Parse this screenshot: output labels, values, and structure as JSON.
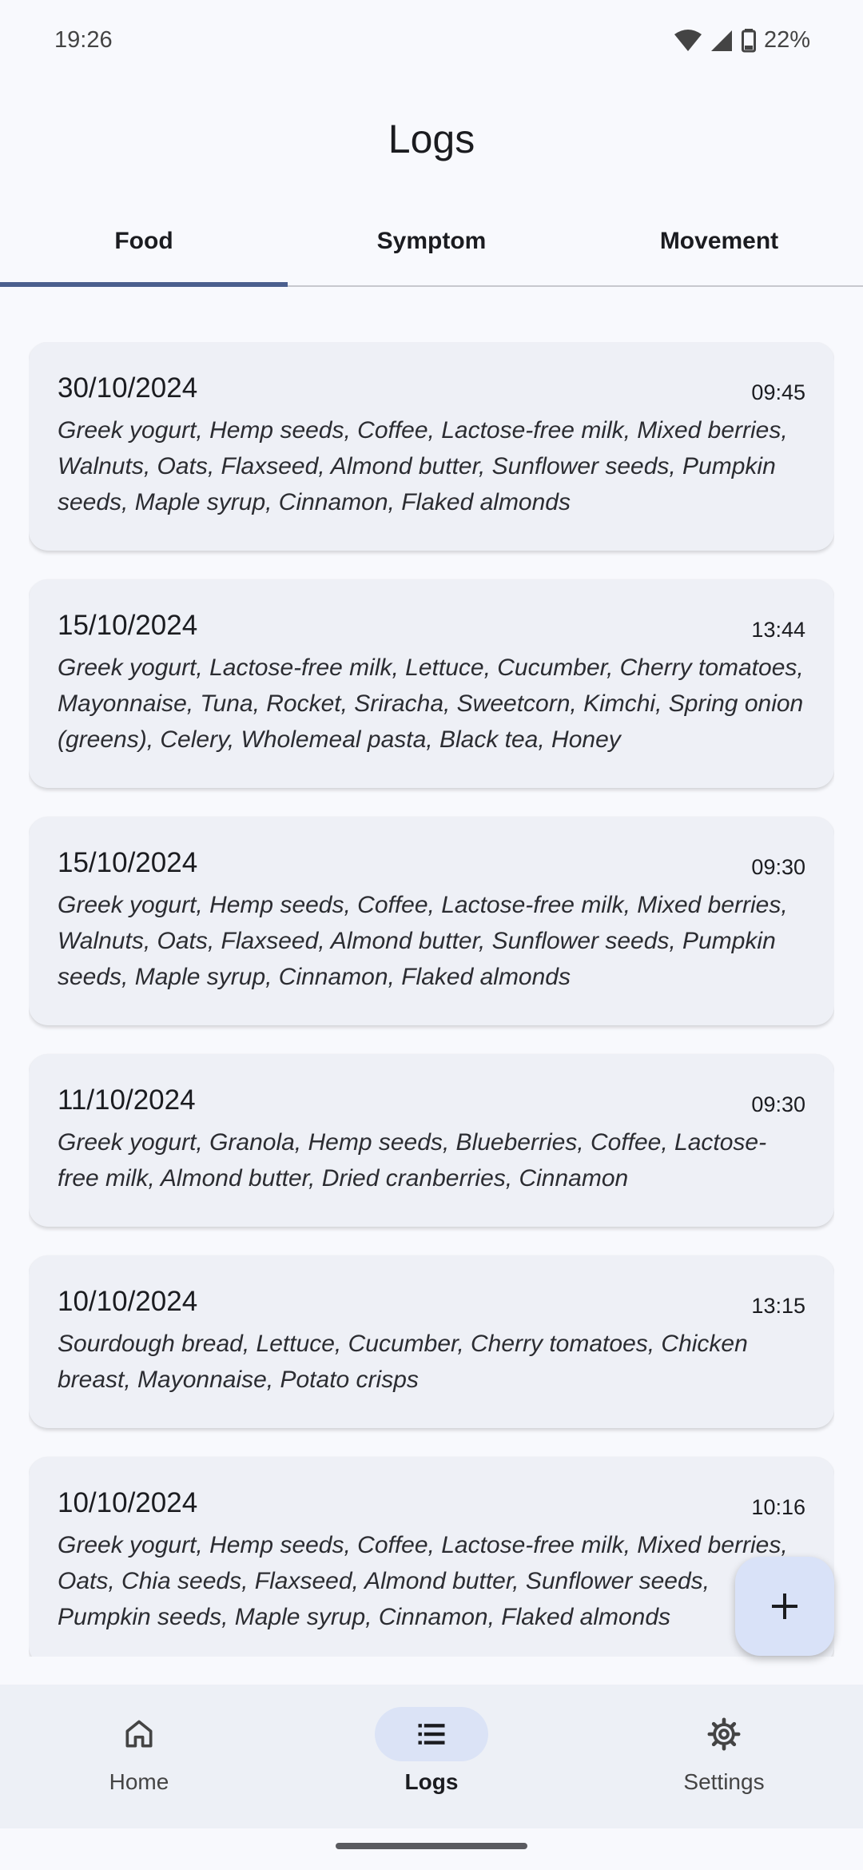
{
  "status": {
    "time": "19:26",
    "battery": "22%"
  },
  "header": {
    "title": "Logs"
  },
  "tabs": [
    {
      "label": "Food",
      "active": true
    },
    {
      "label": "Symptom",
      "active": false
    },
    {
      "label": "Movement",
      "active": false
    }
  ],
  "logs": [
    {
      "date": "30/10/2024",
      "time": "09:45",
      "items": "Greek yogurt, Hemp seeds, Coffee, Lactose-free milk, Mixed berries, Walnuts, Oats, Flaxseed, Almond butter, Sunflower seeds, Pumpkin seeds, Maple syrup, Cinnamon, Flaked almonds"
    },
    {
      "date": "15/10/2024",
      "time": "13:44",
      "items": "Greek yogurt, Lactose-free milk, Lettuce, Cucumber, Cherry tomatoes, Mayonnaise, Tuna, Rocket, Sriracha, Sweetcorn, Kimchi, Spring onion (greens), Celery, Wholemeal pasta, Black tea, Honey"
    },
    {
      "date": "15/10/2024",
      "time": "09:30",
      "items": "Greek yogurt, Hemp seeds, Coffee, Lactose-free milk, Mixed berries, Walnuts, Oats, Flaxseed, Almond butter, Sunflower seeds, Pumpkin seeds, Maple syrup, Cinnamon, Flaked almonds"
    },
    {
      "date": "11/10/2024",
      "time": "09:30",
      "items": "Greek yogurt, Granola, Hemp seeds, Blueberries, Coffee, Lactose-free milk, Almond butter, Dried cranberries, Cinnamon"
    },
    {
      "date": "10/10/2024",
      "time": "13:15",
      "items": "Sourdough bread, Lettuce, Cucumber, Cherry tomatoes, Chicken breast, Mayonnaise, Potato crisps"
    },
    {
      "date": "10/10/2024",
      "time": "10:16",
      "items": "Greek yogurt, Hemp seeds, Coffee, Lactose-free milk, Mixed berries, Oats, Chia seeds, Flaxseed, Almond butter, Sunflower seeds, Pumpkin seeds, Maple syrup, Cinnamon, Flaked almonds"
    }
  ],
  "fab": {
    "icon": "plus-icon"
  },
  "nav": [
    {
      "label": "Home",
      "icon": "home-icon",
      "active": false
    },
    {
      "label": "Logs",
      "icon": "list-icon",
      "active": true
    },
    {
      "label": "Settings",
      "icon": "gear-icon",
      "active": false
    }
  ],
  "colors": {
    "accent": "#4b5f8e",
    "card": "#eef0f6",
    "fab": "#d9e2f8",
    "nav_pill": "#dbe3f6"
  }
}
